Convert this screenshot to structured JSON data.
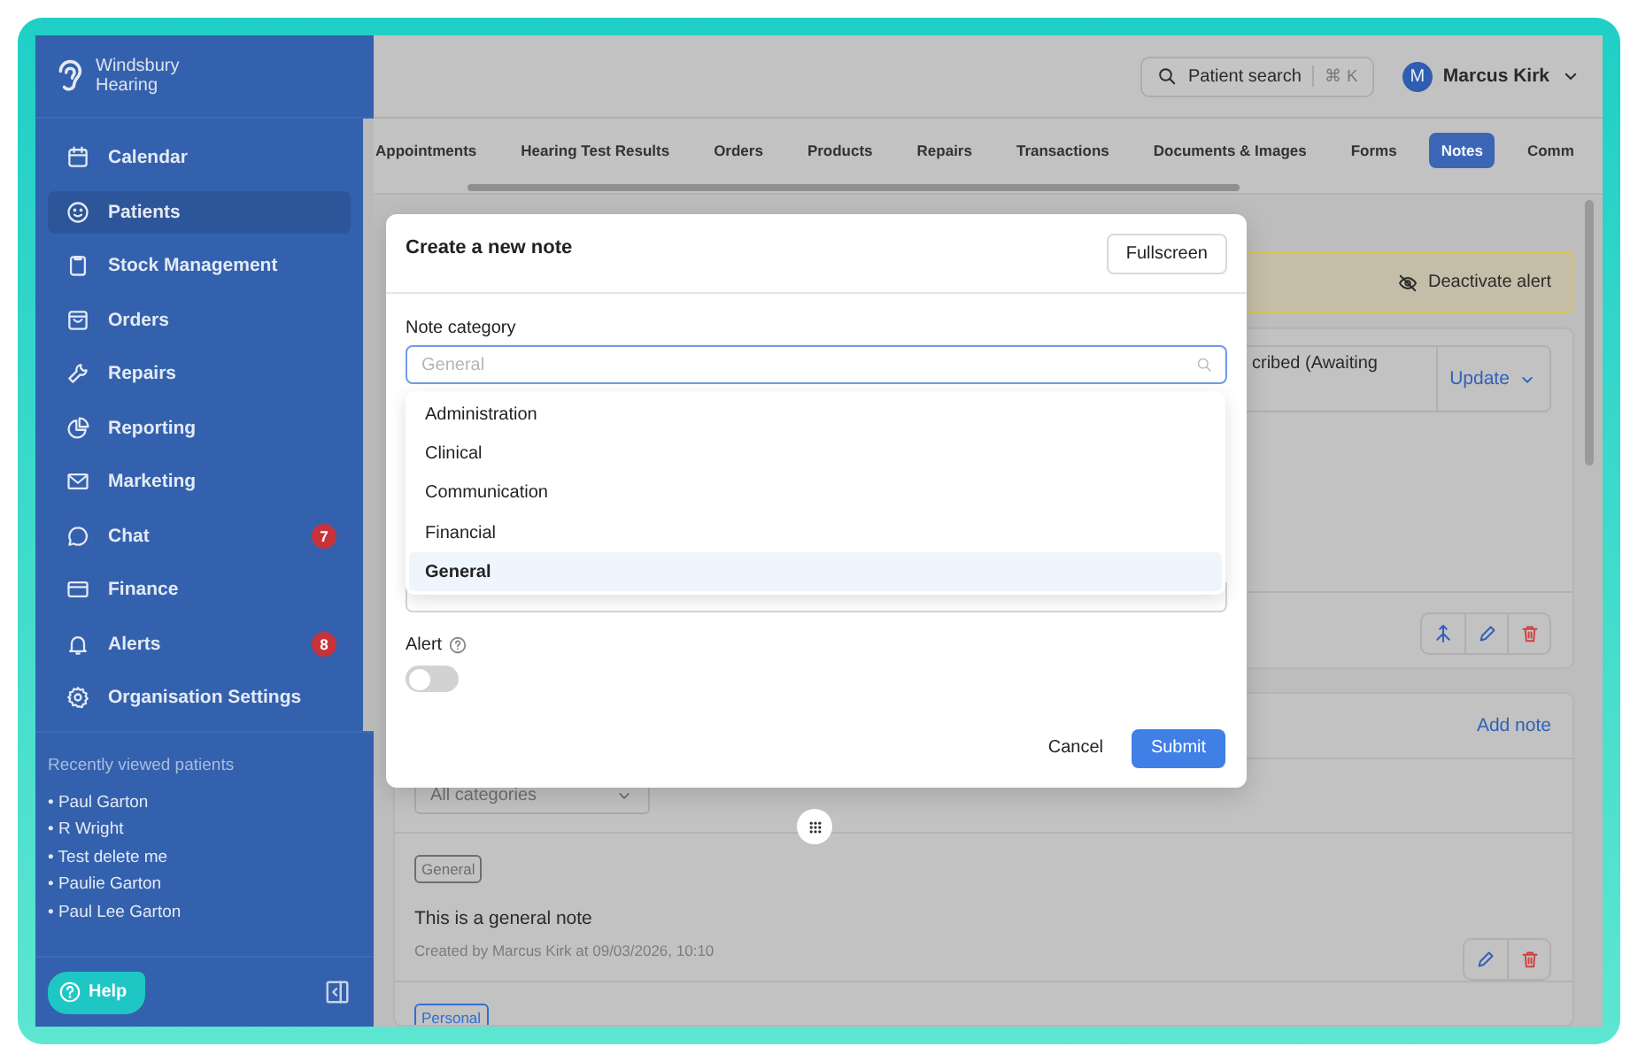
{
  "sidebar": {
    "brand": "Windsbury Hearing",
    "nav": [
      {
        "label": "Calendar",
        "selected": false
      },
      {
        "label": "Patients",
        "selected": true
      },
      {
        "label": "Stock Management",
        "selected": false
      },
      {
        "label": "Orders",
        "selected": false
      },
      {
        "label": "Repairs",
        "selected": false
      },
      {
        "label": "Reporting",
        "selected": false
      },
      {
        "label": "Marketing",
        "selected": false
      },
      {
        "label": "Chat",
        "selected": false,
        "badge": "7"
      },
      {
        "label": "Finance",
        "selected": false
      },
      {
        "label": "Alerts",
        "selected": false,
        "badge": "8"
      },
      {
        "label": "Organisation Settings",
        "selected": false
      }
    ],
    "recent": {
      "title": "Recently viewed patients",
      "patients": [
        "• Paul Garton",
        "• R Wright",
        "• Test delete me",
        "• Paulie Garton",
        "• Paul Lee Garton"
      ]
    },
    "help": "Help"
  },
  "header": {
    "search": {
      "label": "Patient search",
      "shortcut": "⌘ K"
    },
    "user": {
      "initial": "M",
      "name": "Marcus Kirk"
    }
  },
  "tabs": [
    {
      "label": "Appointments",
      "selected": false
    },
    {
      "label": "Hearing Test Results",
      "selected": false
    },
    {
      "label": "Orders",
      "selected": false
    },
    {
      "label": "Products",
      "selected": false
    },
    {
      "label": "Repairs",
      "selected": false
    },
    {
      "label": "Transactions",
      "selected": false
    },
    {
      "label": "Documents & Images",
      "selected": false
    },
    {
      "label": "Forms",
      "selected": false
    },
    {
      "label": "Notes",
      "selected": true
    },
    {
      "label": "Comm",
      "selected": false
    }
  ],
  "alert_banner": {
    "action": "Deactivate alert"
  },
  "status_card": {
    "status": "cribed (Awaiting",
    "action": "Update"
  },
  "notes": {
    "action": "Add note",
    "filter": {
      "placeholder": "All categories"
    },
    "items": [
      {
        "tag": "General",
        "color": "#6e6e6e",
        "text": "This is a general note",
        "meta": "Created by Marcus Kirk at 09/03/2026, 10:10"
      },
      {
        "tag": "Personal",
        "color": "#2f6fd0"
      }
    ]
  },
  "modal": {
    "title": "Create a new note",
    "fullscreen": "Fullscreen",
    "category": {
      "label": "Note category",
      "placeholder": "General",
      "options": [
        {
          "label": "Administration",
          "selected": false
        },
        {
          "label": "Clinical",
          "selected": false
        },
        {
          "label": "Communication",
          "selected": false
        },
        {
          "label": "Financial",
          "selected": false
        },
        {
          "label": "General",
          "selected": true
        }
      ]
    },
    "alert": {
      "label": "Alert",
      "on": false
    },
    "cancel": "Cancel",
    "submit": "Submit"
  }
}
